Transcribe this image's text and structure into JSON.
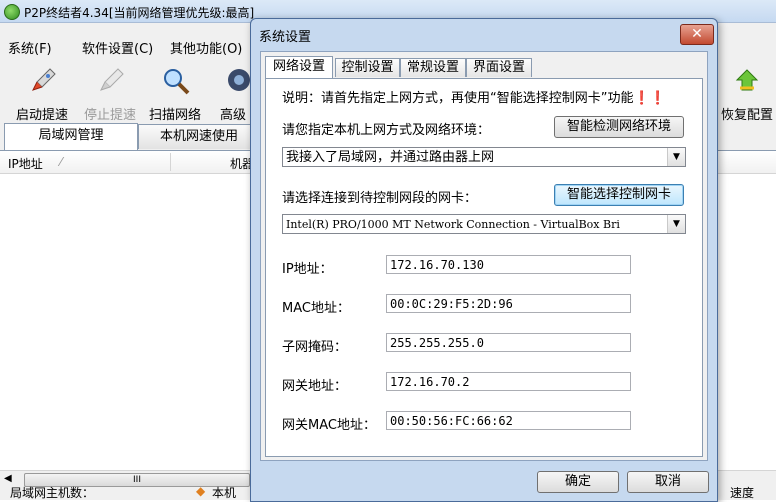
{
  "main_window": {
    "title": "P2P终结者4.34[当前网络管理优先级:最高]",
    "menu": [
      "系统(F)",
      "软件设置(C)",
      "其他功能(O)"
    ],
    "toolbar": [
      "启动提速",
      "停止提速",
      "扫描网络",
      "高级",
      "恢复配置"
    ],
    "tabs": [
      "局域网管理",
      "本机网速使用"
    ],
    "list_columns": [
      "IP地址",
      "机器"
    ],
    "status_left": "局域网主机数：",
    "status_mid": "本机",
    "status_right": "速度"
  },
  "dialog": {
    "title": "系统设置",
    "close_glyph": "✕",
    "tabs": [
      "网络设置",
      "控制设置",
      "常规设置",
      "界面设置"
    ],
    "intro": "说明：请首先指定上网方式，再使用“智能选择控制网卡”功能❗❗",
    "env_label": "请您指定本机上网方式及网络环境：",
    "detect_button": "智能检测网络环境",
    "env_value": "我接入了局域网，并通过路由器上网",
    "nic_label": "请选择连接到待控制网段的网卡：",
    "nic_button": "智能选择控制网卡",
    "nic_value": "Intel(R) PRO/1000 MT Network Connection - VirtualBox Bri",
    "fields": [
      {
        "label": "IP地址：",
        "value": "172.16.70.130"
      },
      {
        "label": "MAC地址：",
        "value": "00:0C:29:F5:2D:96"
      },
      {
        "label": "子网掩码：",
        "value": "255.255.255.0"
      },
      {
        "label": "网关地址：",
        "value": "172.16.70.2"
      },
      {
        "label": "网关MAC地址：",
        "value": "00:50:56:FC:66:62"
      }
    ],
    "ok": "确定",
    "cancel": "取消"
  }
}
